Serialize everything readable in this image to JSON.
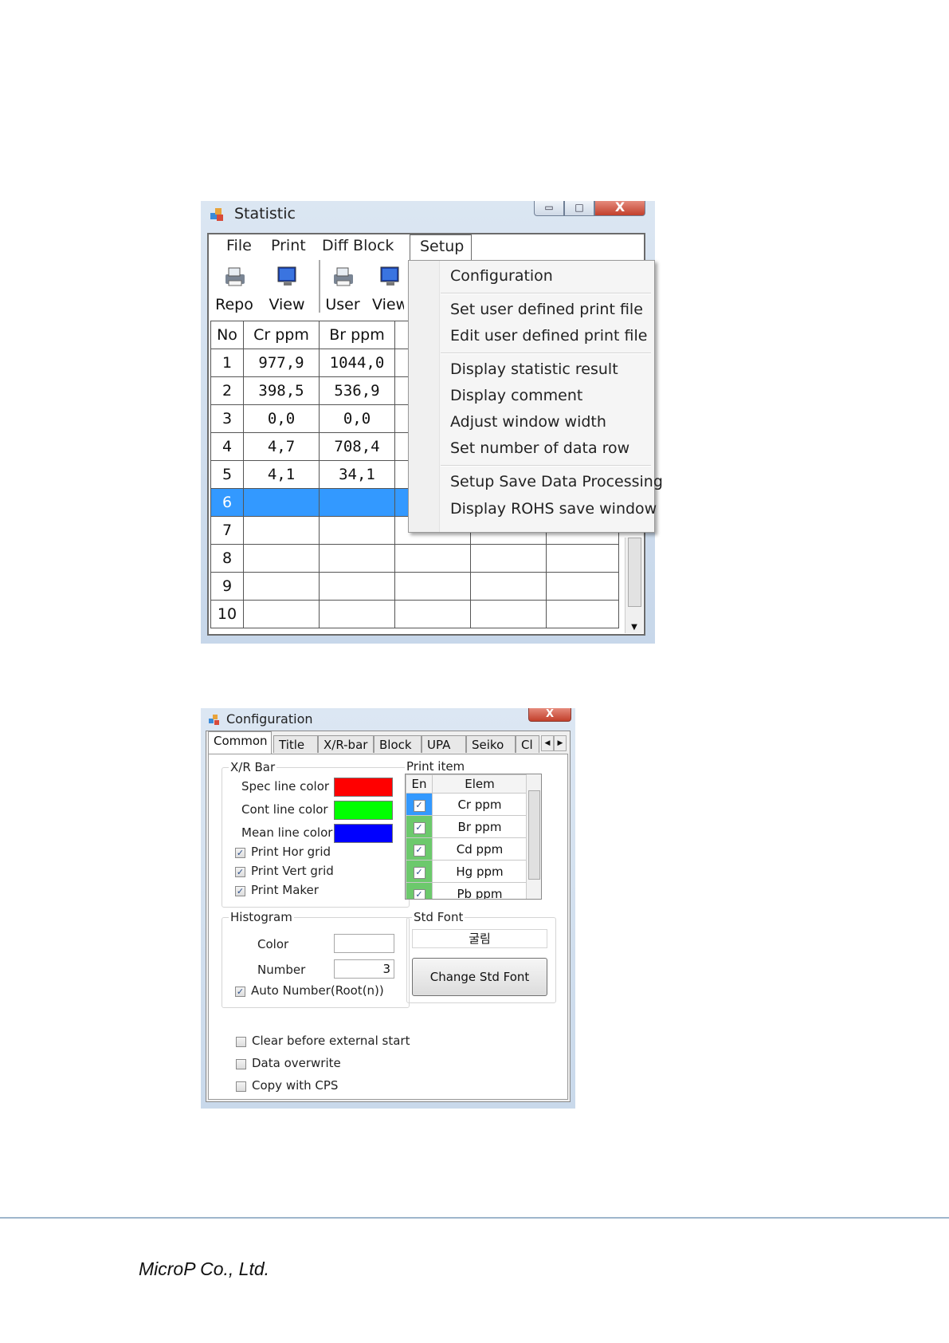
{
  "statistic_window": {
    "title": "Statistic",
    "controls": {
      "minimize": "▭",
      "maximize": "□",
      "close": "X"
    },
    "menu": {
      "file": "File",
      "print": "Print",
      "diff_block": "Diff Block",
      "setup": "Setup"
    },
    "toolbar": {
      "repo": "Repo",
      "view1": "View",
      "user": "User",
      "view2": "View"
    },
    "columns": {
      "no": "No",
      "cr": "Cr ppm",
      "br": "Br ppm"
    },
    "rows": [
      {
        "no": "1",
        "cr": "977,9",
        "br": "1044,0"
      },
      {
        "no": "2",
        "cr": "398,5",
        "br": "536,9"
      },
      {
        "no": "3",
        "cr": "0,0",
        "br": "0,0"
      },
      {
        "no": "4",
        "cr": "4,7",
        "br": "708,4"
      },
      {
        "no": "5",
        "cr": "4,1",
        "br": "34,1"
      },
      {
        "no": "6",
        "cr": "",
        "br": ""
      },
      {
        "no": "7",
        "cr": "",
        "br": ""
      },
      {
        "no": "8",
        "cr": "",
        "br": ""
      },
      {
        "no": "9",
        "cr": "",
        "br": ""
      },
      {
        "no": "10",
        "cr": "",
        "br": ""
      }
    ],
    "selected_row": "6",
    "setup_menu": {
      "configuration": "Configuration",
      "set_print_file": "Set user defined print file",
      "edit_print_file": "Edit user defined print file",
      "display_statistic": "Display statistic result",
      "display_comment": "Display comment",
      "adjust_width": "Adjust window width",
      "set_rows": "Set number of data row",
      "setup_save": "Setup Save Data Processing",
      "display_rohs": "Display ROHS save window"
    }
  },
  "config_window": {
    "title": "Configuration",
    "close": "X",
    "tabs": {
      "common": "Common",
      "title": "Title",
      "xr_bar": "X/R-bar",
      "block": "Block",
      "upa": "UPA",
      "seiko": "Seiko",
      "cl": "Cl"
    },
    "active_tab": "Common",
    "xr_bar": {
      "legend": "X/R Bar",
      "spec_line_color": "Spec line color",
      "cont_line_color": "Cont line color",
      "mean_line_color": "Mean line color",
      "print_hor_grid": "Print Hor grid",
      "print_vert_grid": "Print Vert grid",
      "print_maker": "Print Maker",
      "colors": {
        "spec": "#ff0000",
        "cont": "#00ff00",
        "mean": "#0000ff"
      },
      "checked": {
        "hor_grid": true,
        "vert_grid": true,
        "maker": true
      }
    },
    "print_item": {
      "legend": "Print item",
      "header": {
        "en": "En",
        "elem": "Elem"
      },
      "items": [
        {
          "elem": "Cr ppm",
          "enabled": true
        },
        {
          "elem": "Br ppm",
          "enabled": true
        },
        {
          "elem": "Cd ppm",
          "enabled": true
        },
        {
          "elem": "Hg ppm",
          "enabled": true
        },
        {
          "elem": "Pb ppm",
          "enabled": true
        }
      ],
      "check_mark": "✓"
    },
    "histogram": {
      "legend": "Histogram",
      "color_label": "Color",
      "number_label": "Number",
      "number_value": "3",
      "auto_number": "Auto Number(Root(n))",
      "auto_number_checked": true
    },
    "std_font": {
      "legend": "Std Font",
      "font_name": "굴림",
      "change_button": "Change Std Font"
    },
    "options": {
      "clear_before": "Clear before external start",
      "data_overwrite": "Data overwrite",
      "copy_with_cps": "Copy with CPS"
    }
  },
  "footer": {
    "company": "MicroP Co., Ltd."
  }
}
